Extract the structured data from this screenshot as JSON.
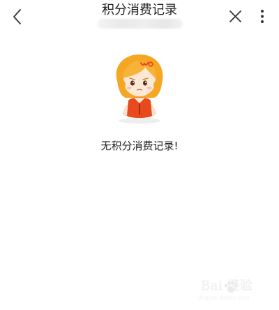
{
  "header": {
    "title": "积分消费记录",
    "back_icon": "chevron-left-icon",
    "close_icon": "close-icon",
    "more_icon": "more-vertical-icon"
  },
  "empty_state": {
    "illustration": "mascot-girl-illustration",
    "message": "无积分消费记录!"
  },
  "watermark": {
    "text": "Bai 经验",
    "url": "jingyan.baidu.com"
  },
  "colors": {
    "background": "#ffffff",
    "text": "#222222",
    "mascot_hair": "#f5a623",
    "mascot_shirt": "#e8491d"
  }
}
